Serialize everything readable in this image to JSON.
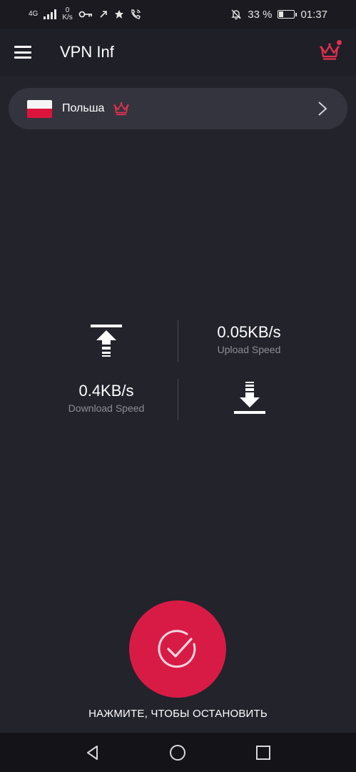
{
  "status_bar": {
    "network_type": "4G",
    "speed_value": "0",
    "speed_unit": "K/s",
    "battery_percent": "33 %",
    "battery_level": 0.33,
    "time": "01:37",
    "icons_left": [
      "signal-icon",
      "key-icon",
      "link-icon",
      "leaf-icon",
      "wifi-call-icon"
    ],
    "icons_right": [
      "mute-icon",
      "battery-icon"
    ]
  },
  "app_bar": {
    "title": "VPN Inf",
    "menu_icon": "menu-icon",
    "premium_icon": "crown-icon",
    "notification_dot": true
  },
  "country": {
    "name": "Польша",
    "flag": "poland-flag",
    "premium_icon": "crown-icon",
    "chevron_icon": "chevron-right-icon"
  },
  "speed": {
    "upload_value": "0.05KB/s",
    "upload_label": "Upload Speed",
    "download_value": "0.4KB/s",
    "download_label": "Download Speed"
  },
  "connect": {
    "label": "НАЖМИТЕ, ЧТОБЫ ОСТАНОВИТЬ",
    "icon": "check-circle-icon",
    "color": "#d81b45"
  },
  "nav_bar": {
    "items": [
      "back-icon",
      "home-icon",
      "recents-icon"
    ]
  },
  "colors": {
    "background": "#23232c",
    "card": "#34343e",
    "accent": "#e5304f",
    "muted_text": "#8d8d96"
  }
}
